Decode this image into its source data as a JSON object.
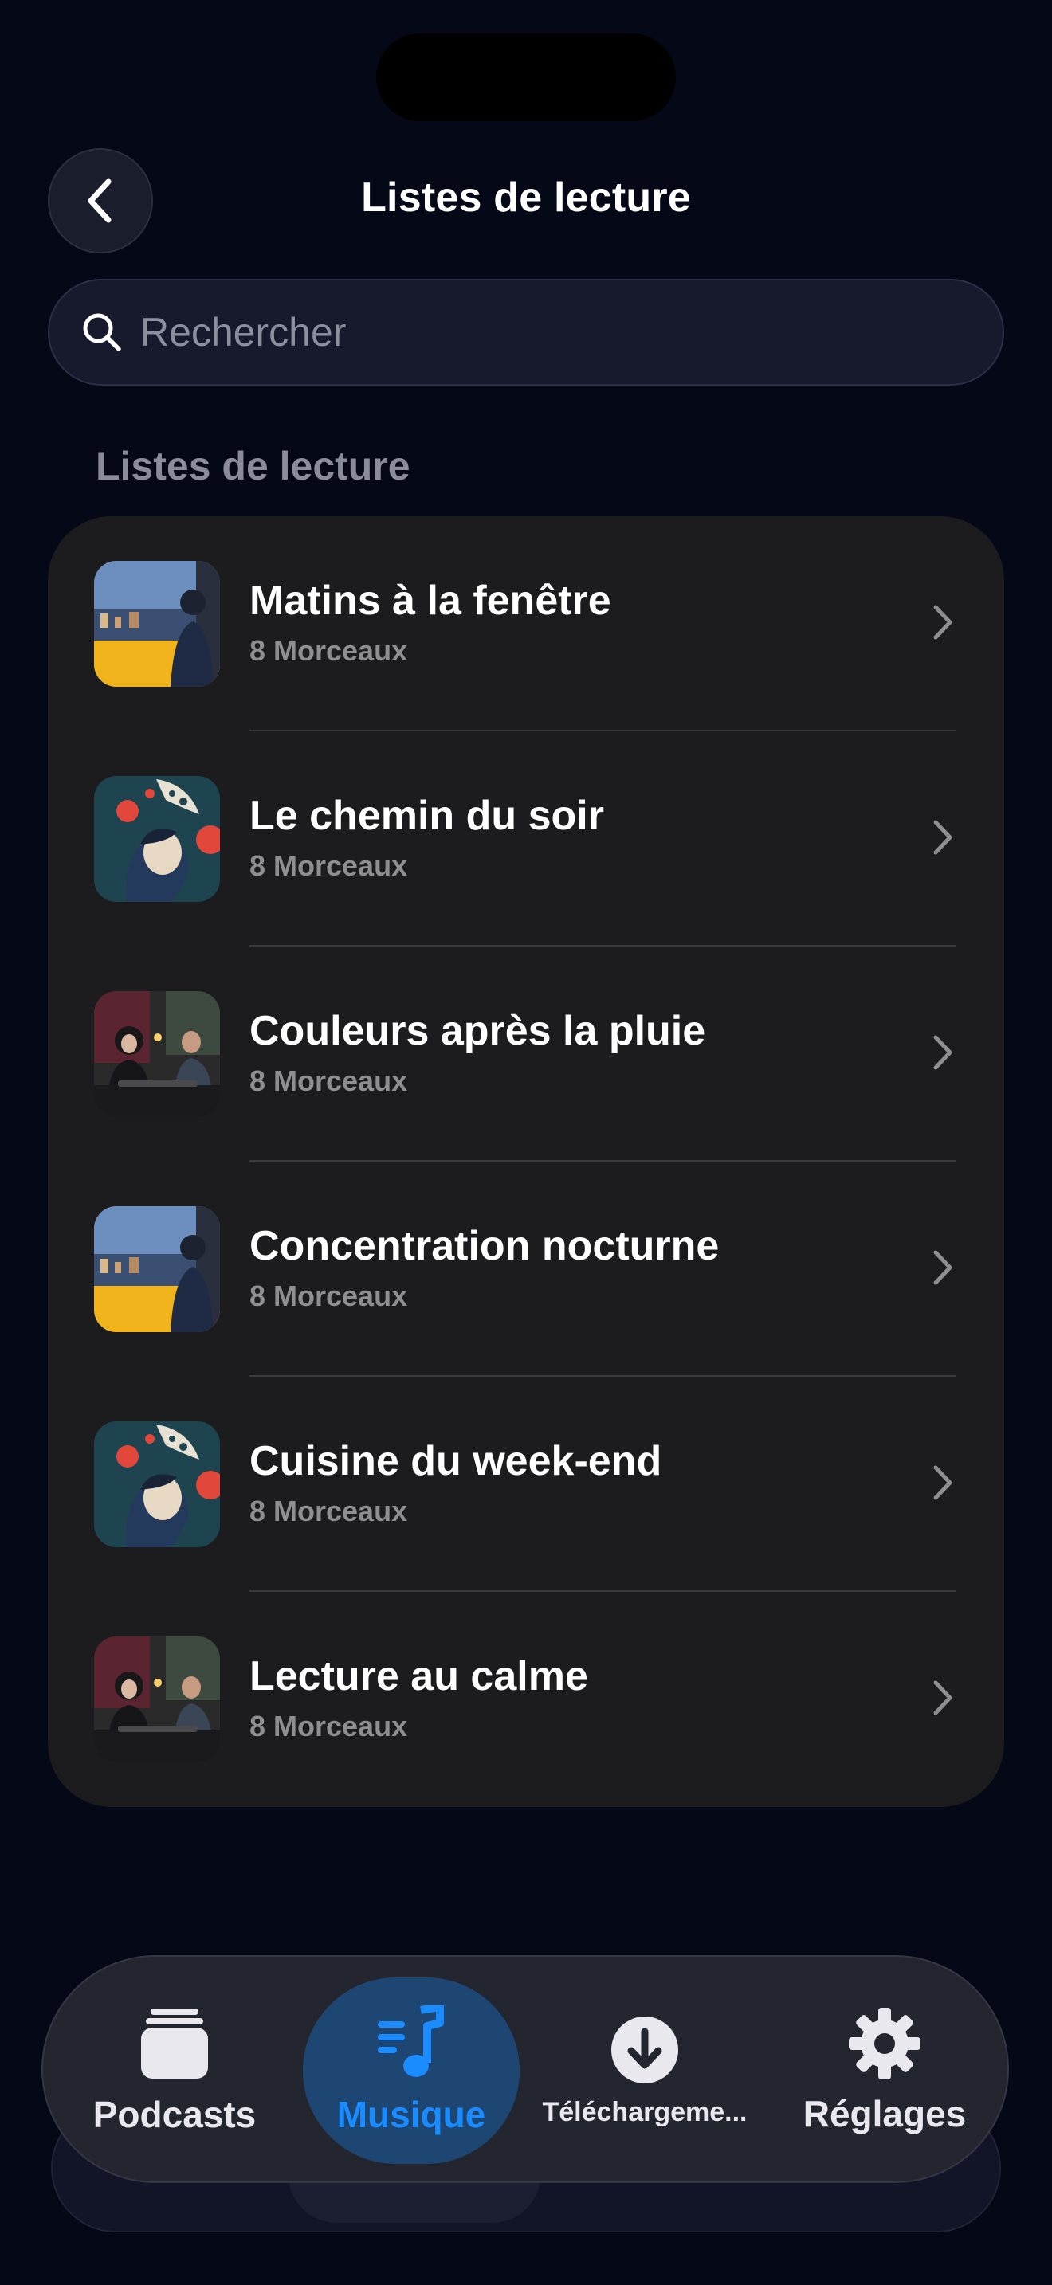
{
  "header": {
    "title": "Listes de lecture"
  },
  "search": {
    "placeholder": "Rechercher"
  },
  "section": {
    "label": "Listes de lecture"
  },
  "playlists": [
    {
      "title": "Matins à la fenêtre",
      "subtitle": "8 Morceaux",
      "artwork": "window-city"
    },
    {
      "title": "Le chemin du soir",
      "subtitle": "8 Morceaux",
      "artwork": "illustration-blue"
    },
    {
      "title": "Couleurs après la pluie",
      "subtitle": "8 Morceaux",
      "artwork": "cafe-scene"
    },
    {
      "title": "Concentration nocturne",
      "subtitle": "8 Morceaux",
      "artwork": "window-city"
    },
    {
      "title": "Cuisine du week-end",
      "subtitle": "8 Morceaux",
      "artwork": "illustration-blue"
    },
    {
      "title": "Lecture au calme",
      "subtitle": "8 Morceaux",
      "artwork": "cafe-scene"
    }
  ],
  "tabbar": {
    "tabs": [
      {
        "label": "Podcasts",
        "icon": "stack-icon",
        "active": false
      },
      {
        "label": "Musique",
        "icon": "music-note-icon",
        "active": true
      },
      {
        "label": "Téléchargeme...",
        "icon": "download-icon",
        "active": false
      },
      {
        "label": "Réglages",
        "icon": "gear-icon",
        "active": false
      }
    ]
  },
  "colors": {
    "background": "#050816",
    "card": "#1c1c1e",
    "accent": "#1a8cff",
    "secondary_text": "#8e8e93"
  }
}
